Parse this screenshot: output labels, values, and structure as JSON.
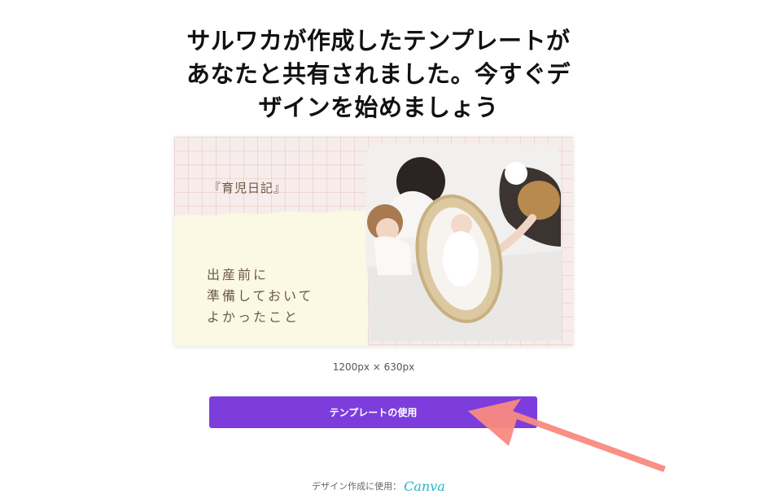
{
  "headline": {
    "line1": "サルワカが作成したテンプレートが",
    "line2": "あなたと共有されました。今すぐデ",
    "line3": "ザインを始めましょう"
  },
  "preview": {
    "title": "『育児日記』",
    "subtitle_line1": "出産前に",
    "subtitle_line2": "準備しておいて",
    "subtitle_line3": "よかったこと"
  },
  "dimensions_label": "1200px × 630px",
  "use_button_label": "テンプレートの使用",
  "footer": {
    "prefix": "デザイン作成に使用：",
    "logo": "Canva"
  },
  "colors": {
    "button": "#7d3ddd",
    "arrow": "#f98a7e",
    "logo": "#27b6c9"
  }
}
